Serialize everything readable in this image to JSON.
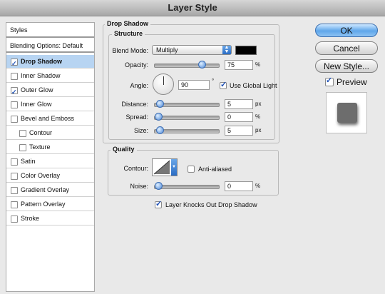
{
  "window": {
    "title": "Layer Style"
  },
  "sidebar": {
    "header": "Styles",
    "blending": "Blending Options: Default",
    "items": [
      {
        "label": "Drop Shadow",
        "checked": true,
        "selected": true,
        "indent": false
      },
      {
        "label": "Inner Shadow",
        "checked": false,
        "selected": false,
        "indent": false
      },
      {
        "label": "Outer Glow",
        "checked": true,
        "selected": false,
        "indent": false
      },
      {
        "label": "Inner Glow",
        "checked": false,
        "selected": false,
        "indent": false
      },
      {
        "label": "Bevel and Emboss",
        "checked": false,
        "selected": false,
        "indent": false
      },
      {
        "label": "Contour",
        "checked": false,
        "selected": false,
        "indent": true
      },
      {
        "label": "Texture",
        "checked": false,
        "selected": false,
        "indent": true
      },
      {
        "label": "Satin",
        "checked": false,
        "selected": false,
        "indent": false
      },
      {
        "label": "Color Overlay",
        "checked": false,
        "selected": false,
        "indent": false
      },
      {
        "label": "Gradient Overlay",
        "checked": false,
        "selected": false,
        "indent": false
      },
      {
        "label": "Pattern Overlay",
        "checked": false,
        "selected": false,
        "indent": false
      },
      {
        "label": "Stroke",
        "checked": false,
        "selected": false,
        "indent": false
      }
    ]
  },
  "drop_shadow": {
    "title": "Drop Shadow",
    "structure_title": "Structure",
    "blend_mode_label": "Blend Mode:",
    "blend_mode_value": "Multiply",
    "shadow_color": "#000000",
    "opacity_label": "Opacity:",
    "opacity_value": "75",
    "opacity_unit": "%",
    "opacity_level": 0.75,
    "angle_label": "Angle:",
    "angle_value": "90",
    "angle_unit": "°",
    "use_global_light_label": "Use Global Light",
    "use_global_light": true,
    "distance_label": "Distance:",
    "distance_value": "5",
    "distance_unit": "px",
    "distance_level": 0.02,
    "spread_label": "Spread:",
    "spread_value": "0",
    "spread_unit": "%",
    "spread_level": 0.0,
    "size_label": "Size:",
    "size_value": "5",
    "size_unit": "px",
    "size_level": 0.02
  },
  "quality": {
    "title": "Quality",
    "contour_label": "Contour:",
    "anti_aliased_label": "Anti-aliased",
    "anti_aliased": false,
    "noise_label": "Noise:",
    "noise_value": "0",
    "noise_unit": "%",
    "noise_level": 0.0
  },
  "knockout": {
    "label": "Layer Knocks Out Drop Shadow",
    "checked": true
  },
  "buttons": {
    "ok": "OK",
    "cancel": "Cancel",
    "new_style": "New Style..."
  },
  "preview": {
    "label": "Preview",
    "checked": true
  }
}
